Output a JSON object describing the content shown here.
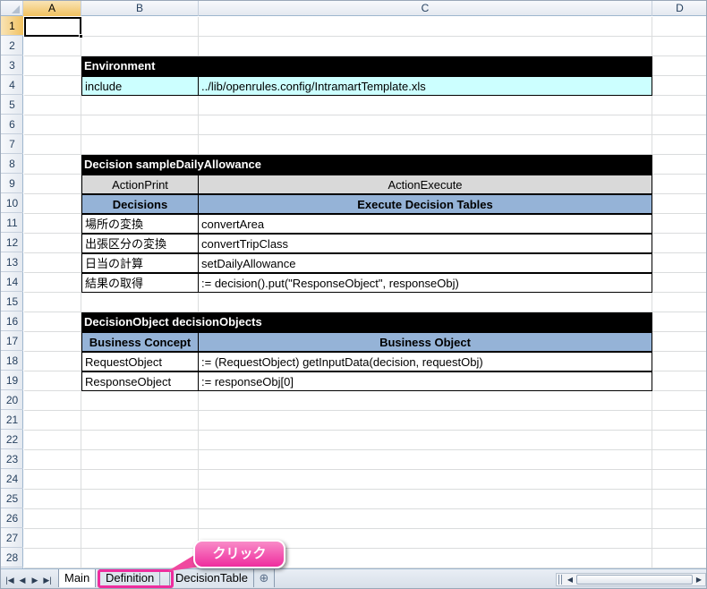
{
  "columns": [
    "A",
    "B",
    "C",
    "D"
  ],
  "rows": [
    "1",
    "2",
    "3",
    "4",
    "5",
    "6",
    "7",
    "8",
    "9",
    "10",
    "11",
    "12",
    "13",
    "14",
    "15",
    "16",
    "17",
    "18",
    "19",
    "20",
    "21",
    "22",
    "23",
    "24",
    "25",
    "26",
    "27",
    "28"
  ],
  "environment": {
    "title": "Environment",
    "key": "include",
    "value": "../lib/openrules.config/IntramartTemplate.xls"
  },
  "decision": {
    "title": "Decision sampleDailyAllowance",
    "type_left": "ActionPrint",
    "type_right": "ActionExecute",
    "header_left": "Decisions",
    "header_right": "Execute Decision Tables",
    "rows": [
      {
        "name": "場所の変換",
        "value": "convertArea"
      },
      {
        "name": "出張区分の変換",
        "value": "convertTripClass"
      },
      {
        "name": "日当の計算",
        "value": "setDailyAllowance"
      },
      {
        "name": "結果の取得",
        "value": ":= decision().put(\"ResponseObject\", responseObj)"
      }
    ]
  },
  "decision_objects": {
    "title": "DecisionObject decisionObjects",
    "header_left": "Business Concept",
    "header_right": "Business Object",
    "rows": [
      {
        "name": "RequestObject",
        "value": ":=  (RequestObject) getInputData(decision, requestObj)"
      },
      {
        "name": "ResponseObject",
        "value": ":=  responseObj[0]"
      }
    ]
  },
  "sheet_tabs": [
    "Main",
    "Definition",
    "DecisionTable"
  ],
  "callout": {
    "text": "クリック"
  },
  "colors": {
    "header_black": "#000000",
    "env_cyan": "#ccffff",
    "type_gray": "#d9d9d9",
    "header_blue": "#95b3d7",
    "callout_pink": "#ee2d9e"
  }
}
